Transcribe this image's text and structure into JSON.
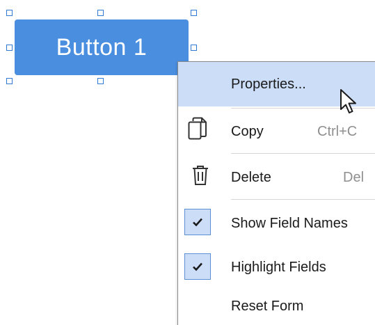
{
  "form_button": {
    "label": "Button 1",
    "color": "#4a8ee0"
  },
  "context_menu": {
    "highlight_color": "#ccdef7",
    "items": [
      {
        "label": "Properties...",
        "shortcut": "",
        "icon": "",
        "highlighted": true
      },
      {
        "label": "Copy",
        "shortcut": "Ctrl+C",
        "icon": "copy-icon"
      },
      {
        "label": "Delete",
        "shortcut": "Del",
        "icon": "trash-icon"
      },
      {
        "label": "Show Field Names",
        "shortcut": "",
        "icon": "checkmark-icon",
        "checked": true
      },
      {
        "label": "Highlight Fields",
        "shortcut": "",
        "icon": "checkmark-icon",
        "checked": true
      },
      {
        "label": "Reset Form",
        "shortcut": "",
        "icon": ""
      }
    ]
  },
  "cursor": {
    "icon": "mouse-pointer-icon"
  }
}
